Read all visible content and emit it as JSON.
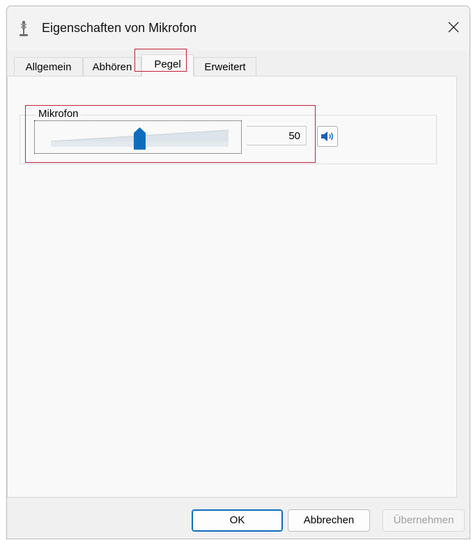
{
  "window": {
    "title": "Eigenschaften von Mikrofon",
    "title_icon": "microphone-icon",
    "close_icon": "close-icon"
  },
  "tabs": [
    {
      "label": "Allgemein",
      "active": false
    },
    {
      "label": "Abhören",
      "active": false
    },
    {
      "label": "Pegel",
      "active": true
    },
    {
      "label": "Erweitert",
      "active": false
    }
  ],
  "level": {
    "group_label": "Mikrofon",
    "value": "50",
    "slider_fraction": 0.5,
    "speaker_icon": "speaker-icon"
  },
  "buttons": {
    "ok": "OK",
    "cancel": "Abbrechen",
    "apply": "Übernehmen"
  },
  "colors": {
    "accent": "#0f6cbd",
    "highlight": "#c21f39"
  }
}
